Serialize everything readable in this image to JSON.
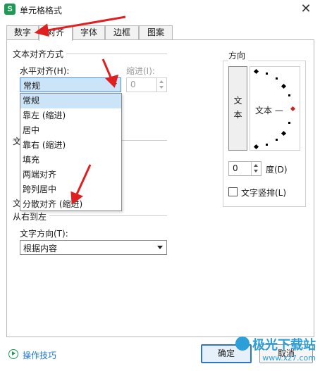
{
  "window": {
    "app_icon_letter": "S",
    "title": "单元格格式",
    "close_glyph": "✕"
  },
  "tabs": [
    {
      "label": "数字"
    },
    {
      "label": "对齐",
      "active": true
    },
    {
      "label": "字体"
    },
    {
      "label": "边框"
    },
    {
      "label": "图案"
    }
  ],
  "alignment": {
    "group_title": "文本对齐方式",
    "horizontal_label": "水平对齐(H):",
    "horizontal_value": "常规",
    "indent_label": "缩进(I):",
    "indent_value": "0",
    "options": [
      "常规",
      "靠左 (缩进)",
      "居中",
      "靠右 (缩进)",
      "填充",
      "两端对齐",
      "跨列居中",
      "分散对齐 (缩进)"
    ],
    "selected_option_index": 0
  },
  "text_control": {
    "partial_label_1": "文",
    "partial_label_2": "文"
  },
  "rtl": {
    "group_title": "从右到左",
    "direction_label": "文字方向(T):",
    "direction_value": "根据内容"
  },
  "orientation": {
    "group_title": "方向",
    "vertical_text": [
      "文",
      "本"
    ],
    "dial_label": "文本 —",
    "degree_value": "0",
    "degree_label": "度(D)",
    "vertical_checkbox_label": "文字竖排(L)",
    "vertical_checked": false
  },
  "footer": {
    "tips_link": "操作技巧",
    "ok_label": "确定",
    "cancel_label": "取消"
  },
  "watermark": {
    "main": "极光下载站",
    "sub": "www.xz7.com"
  },
  "colors": {
    "accent_green": "#1c9a55",
    "link_blue": "#1c7ad4",
    "selection_blue": "#cce4f7",
    "annotation_red": "#e02020",
    "watermark_blue": "#2c9fd8"
  }
}
